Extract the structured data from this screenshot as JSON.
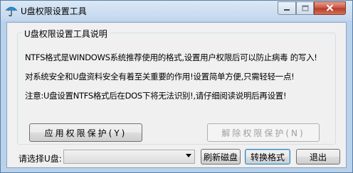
{
  "window": {
    "title": "U盘权限设置工具"
  },
  "group": {
    "title": "U盘权限设置工具说明",
    "lines": [
      "NTFS格式是WINDOWS系统推荐使用的格式,设置用户权限后可以防止病毒 的写入!",
      "对系统安全和U盘资料安全有着至关重要的作用!设置简单方便,只需轻轻一点!",
      "注意:U盘设置NTFS格式后在DOS下将无法识别!,请仔细阅读说明后再设置!"
    ],
    "apply_button": "应用权限保护(Y)",
    "remove_button": "解除权限保护(N)"
  },
  "bottom": {
    "select_label": "请选择U盘:",
    "drive_value": "",
    "refresh_button": "刷新磁盘",
    "convert_button": "转换格式",
    "exit_button": "退出"
  },
  "icons": {
    "app": "umbrella-icon",
    "minimize": "minimize-icon",
    "maximize": "maximize-icon",
    "close": "close-icon",
    "dropdown": "chevron-down-icon"
  },
  "colors": {
    "close_button": "#c7513e",
    "disabled_text": "#a0a0a0"
  }
}
